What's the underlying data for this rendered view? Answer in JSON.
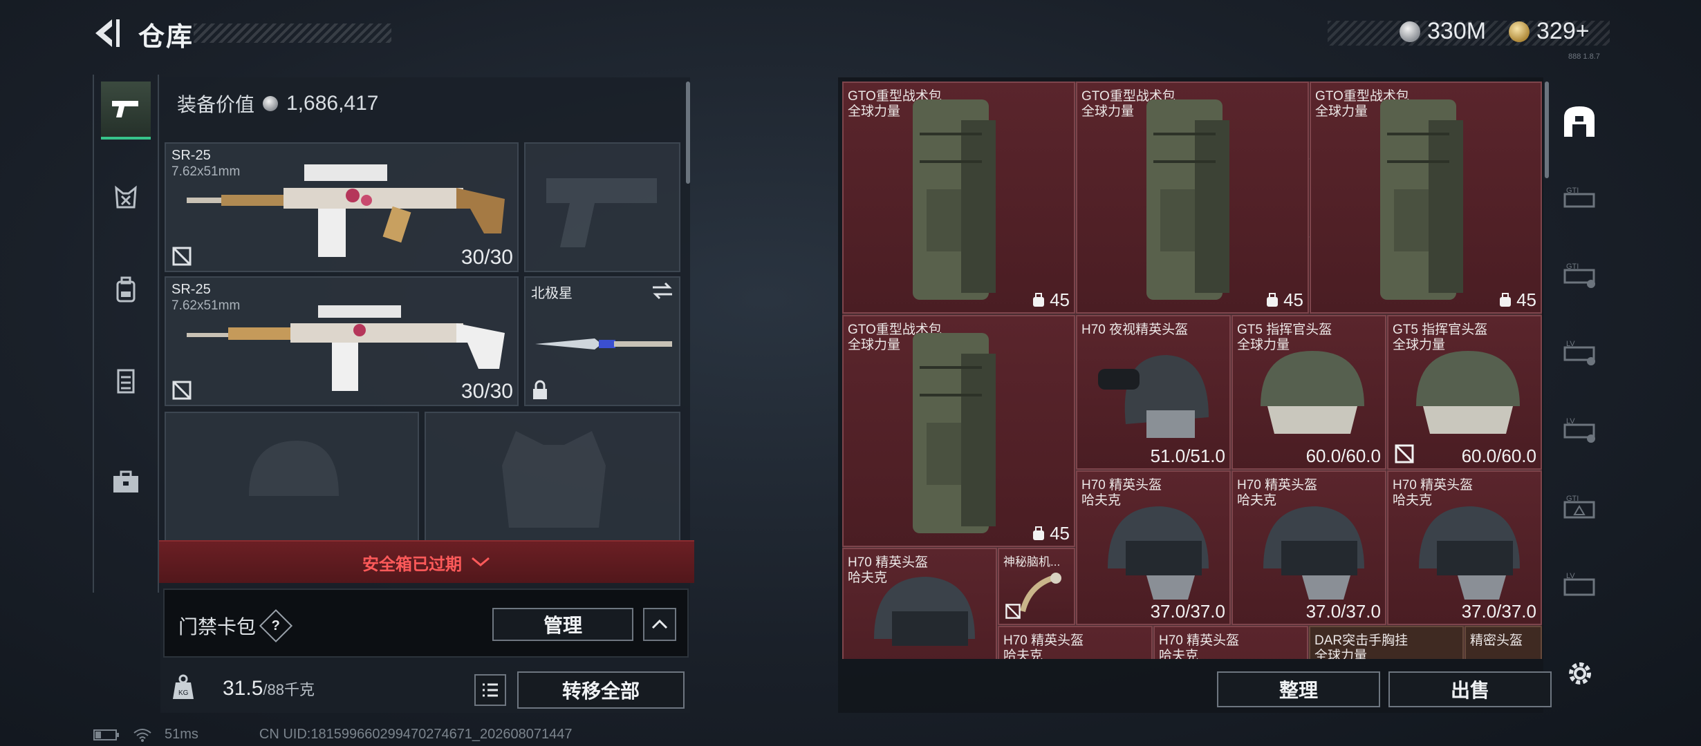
{
  "header": {
    "title": "仓库",
    "currency_silver": "330M",
    "currency_gold": "329+",
    "version_text": "888 1.8.7"
  },
  "sidebar": {
    "items": [
      {
        "name": "weapon",
        "icon": "pistol-icon",
        "active": true
      },
      {
        "name": "rig",
        "icon": "chest-rig-icon",
        "active": false
      },
      {
        "name": "backpack",
        "icon": "backpack-icon",
        "active": false
      },
      {
        "name": "armor",
        "icon": "vest-icon",
        "active": false
      },
      {
        "name": "case",
        "icon": "briefcase-icon",
        "active": false
      }
    ]
  },
  "equipment": {
    "value_label": "装备价值",
    "value": "1,686,417",
    "primary_1": {
      "name": "SR-25",
      "caliber": "7.62x51mm",
      "ammo": "30/30"
    },
    "primary_2": {
      "name": "SR-25",
      "caliber": "7.62x51mm",
      "ammo": "30/30"
    },
    "melee": {
      "name": "北极星"
    },
    "expired_text": "安全箱已过期",
    "keycard_label": "门禁卡包",
    "keycard_help": "?",
    "manage_label": "管理",
    "weight_value": "31.5",
    "weight_cap": "/88千克",
    "transfer_all_label": "转移全部"
  },
  "stash": {
    "items": [
      {
        "name": "GTO重型战术包",
        "sub": "全球力量",
        "count": "45"
      },
      {
        "name": "GTO重型战术包",
        "sub": "全球力量",
        "count": "45"
      },
      {
        "name": "GTO重型战术包",
        "sub": "全球力量",
        "count": "45"
      },
      {
        "name": "GTO重型战术包",
        "sub": "全球力量",
        "count": "45"
      },
      {
        "name": "H70 夜视精英头盔",
        "sub": "",
        "dur": "51.0/51.0"
      },
      {
        "name": "GT5 指挥官头盔",
        "sub": "全球力量",
        "dur": "60.0/60.0"
      },
      {
        "name": "GT5 指挥官头盔",
        "sub": "全球力量",
        "dur": "60.0/60.0"
      },
      {
        "name": "H70 精英头盔",
        "sub": "哈夫克",
        "dur": "37.0/37.0"
      },
      {
        "name": "H70 精英头盔",
        "sub": "哈夫克",
        "dur": "37.0/37.0"
      },
      {
        "name": "H70 精英头盔",
        "sub": "哈夫克",
        "dur": "37.0/37.0"
      },
      {
        "name": "H70 精英头盔",
        "sub": "哈夫克"
      },
      {
        "name": "神秘脑机...",
        "sub": ""
      },
      {
        "name": "H70 精英头盔",
        "sub": "哈夫克"
      },
      {
        "name": "H70 精英头盔",
        "sub": "哈夫克"
      },
      {
        "name": "DAR突击手胸挂",
        "sub": "全球力量"
      },
      {
        "name": "精密头盔",
        "sub": ""
      }
    ],
    "sort_label": "整理",
    "sell_label": "出售"
  },
  "right_strip": {
    "items": [
      "stash-home-icon",
      "gti-container-icon",
      "gti-container-2-icon",
      "lv-container-icon",
      "lv-container-2-icon",
      "gti-container-3-icon",
      "lv-container-3-icon"
    ]
  },
  "status": {
    "ping": "51ms",
    "uid": "CN UID:18159966029947027467​1_202608071447"
  },
  "colors": {
    "accent_green": "#37c48a",
    "expired_red": "#ff5a5a",
    "stash_cell": "#5a252c"
  }
}
